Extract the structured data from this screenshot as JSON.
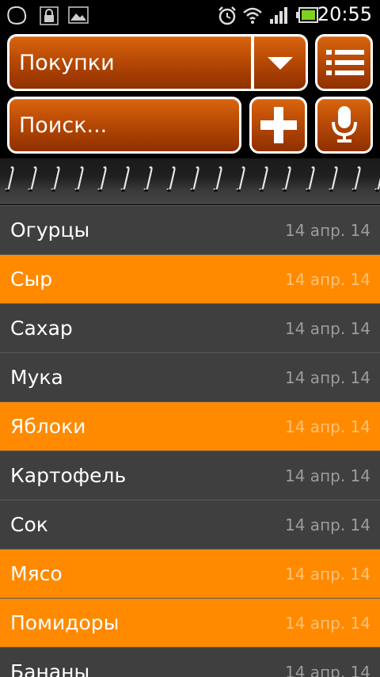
{
  "status_bar": {
    "time": "20:55",
    "icons": [
      "notification-icon",
      "lock-icon",
      "image-icon",
      "alarm-icon",
      "wifi-icon",
      "signal-icon",
      "battery-icon"
    ]
  },
  "toolbar": {
    "list_name": "Покупки",
    "search_placeholder": "Поиск...",
    "accent": "#ff8a00",
    "button_color": "#b94a05"
  },
  "items": [
    {
      "name": "Огурцы",
      "date": "14 апр. 14",
      "highlight": false
    },
    {
      "name": "Сыр",
      "date": "14 апр. 14",
      "highlight": true
    },
    {
      "name": "Сахар",
      "date": "14 апр. 14",
      "highlight": false
    },
    {
      "name": "Мука",
      "date": "14 апр. 14",
      "highlight": false
    },
    {
      "name": "Яблоки",
      "date": "14 апр. 14",
      "highlight": true
    },
    {
      "name": "Картофель",
      "date": "14 апр. 14",
      "highlight": false
    },
    {
      "name": "Сок",
      "date": "14 апр. 14",
      "highlight": false
    },
    {
      "name": "Мясо",
      "date": "14 апр. 14",
      "highlight": true
    },
    {
      "name": "Помидоры",
      "date": "14 апр. 14",
      "highlight": true
    },
    {
      "name": "Бананы",
      "date": "14 апр. 14",
      "highlight": false
    }
  ]
}
